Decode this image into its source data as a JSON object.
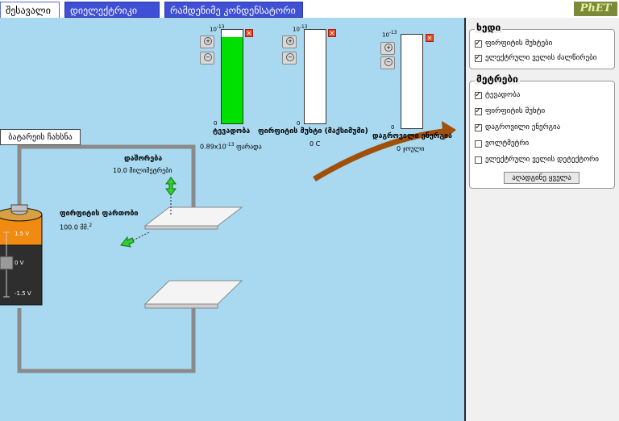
{
  "tabs": {
    "intro": "შესავალი",
    "dielectric": "დიელექტრიკი",
    "multiple": "რამდენიმე კონდენსატორი"
  },
  "logo": "PhET",
  "stage": {
    "battery_button": "ბატარეის ჩახსნა",
    "separation_label": "დაშორება",
    "separation_value": "10.0 მილიმეტრები",
    "plate_area_label": "ფირფიტის ფართობი",
    "plate_area_value": "100.0 მმ.",
    "plate_area_sup": "2",
    "battery_plus": "1.5 V",
    "battery_zero": "0 V",
    "battery_minus": "-1.5 V"
  },
  "meters": {
    "capacitance": {
      "top": "10",
      "top_exp": "-13",
      "bottom": "0",
      "title": "ტევადობა",
      "value": "0.89x10",
      "value_exp": "-13",
      "unit": " ფარადა",
      "fill": 0.92
    },
    "charge": {
      "top": "10",
      "top_exp": "-13",
      "bottom": "0",
      "title": "ფირფიტის მუხტი (მაქსიმუმი)",
      "value": "0 C",
      "fill": 0
    },
    "energy": {
      "top": "10",
      "top_exp": "-13",
      "bottom": "0",
      "title": "დაგროვილი ენერგია",
      "value": "0 ჯოული",
      "fill": 0
    }
  },
  "panel": {
    "view_title": "ხედი",
    "view_items": [
      {
        "label": "ფირფიტის მუხტები",
        "checked": true
      },
      {
        "label": "ელექტრული ველის ძალწირები",
        "checked": true
      }
    ],
    "meters_title": "მეტრები",
    "meter_items": [
      {
        "label": "ტევადობა",
        "checked": true
      },
      {
        "label": "ფირფიტის მუხტი",
        "checked": true
      },
      {
        "label": "დაგროვილი ენერგია",
        "checked": true
      },
      {
        "label": "ვოლტმეტრი",
        "checked": false
      },
      {
        "label": "ელექტრული ველის დეტექტორი",
        "checked": false
      }
    ],
    "reset_label": "აღადგინე ყველა"
  },
  "colors": {
    "background": "#a9d9f0",
    "tab_active": "#ffffff",
    "tab_inactive": "#3f4fd6",
    "meter_fill": "#00e000",
    "arrow": "#a0500a"
  }
}
